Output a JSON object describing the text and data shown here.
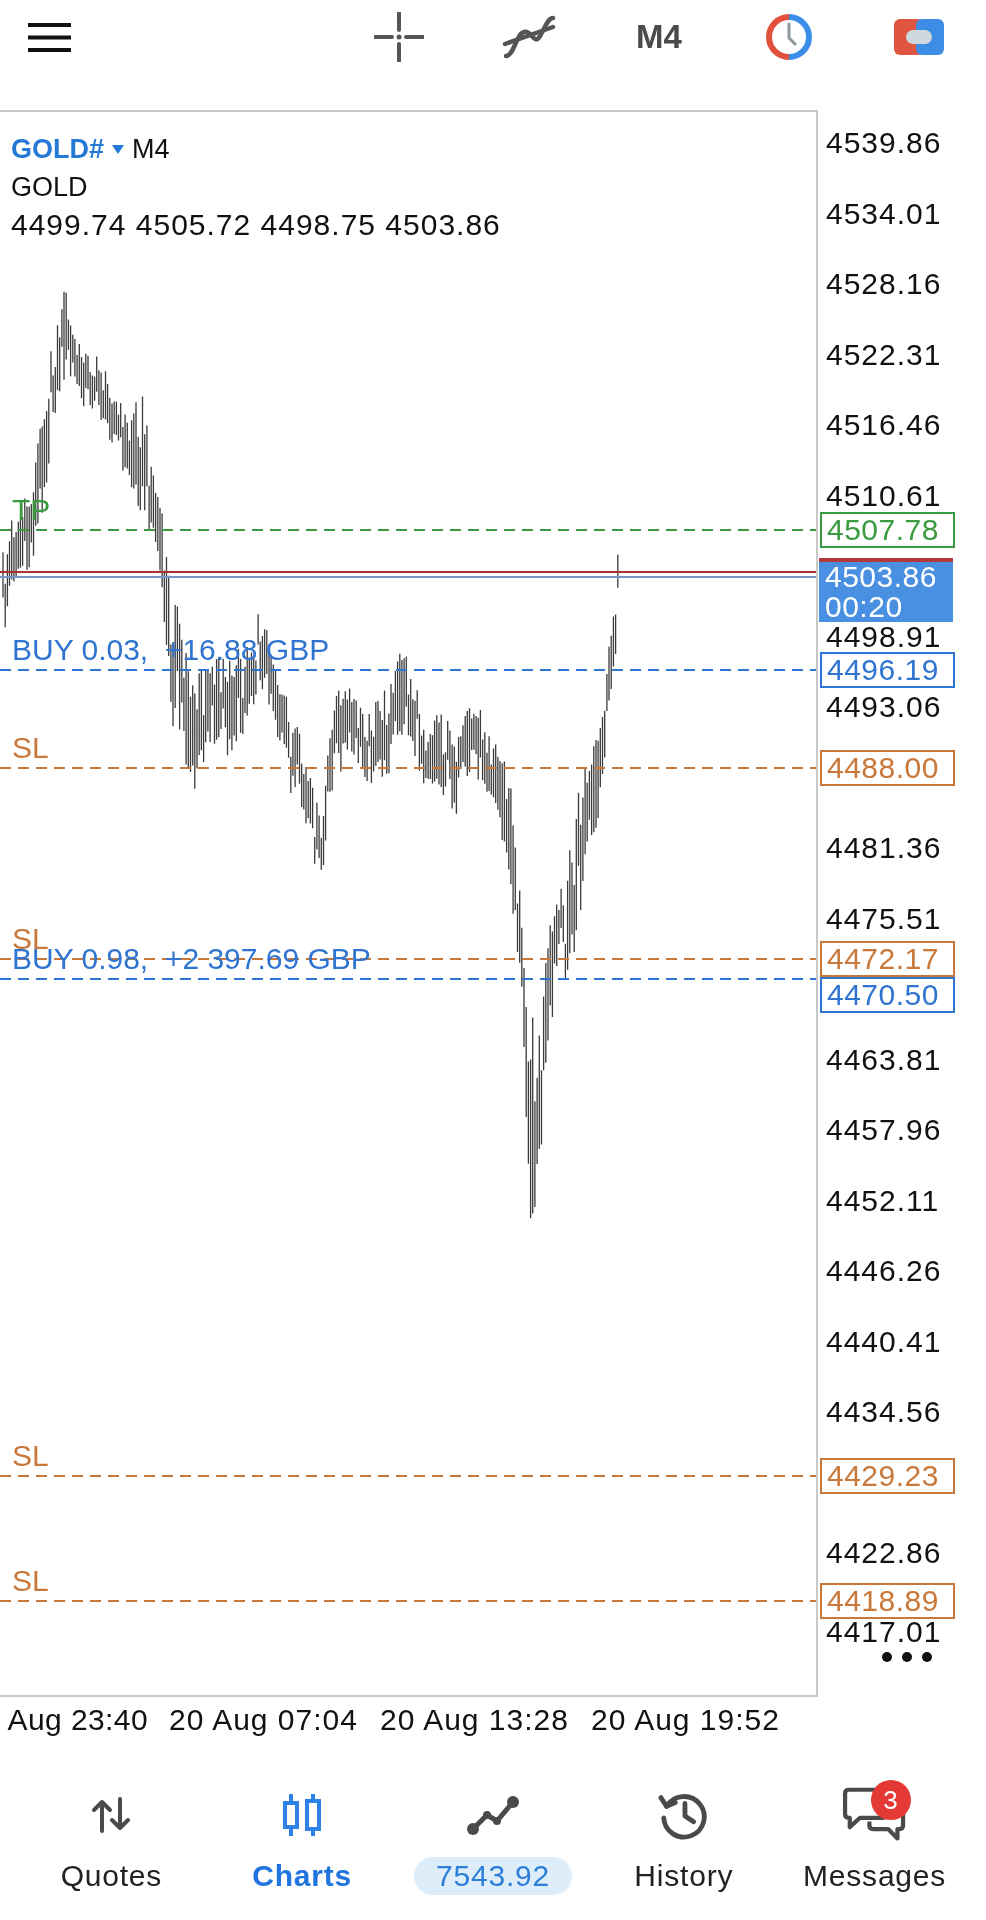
{
  "top_bar": {
    "timeframe": "M4"
  },
  "chart": {
    "symbol": "GOLD#",
    "timeframe": "M4",
    "description": "GOLD",
    "ohlc": "4499.74 4505.72 4498.75 4503.86",
    "price_axis": [
      "4539.86",
      "4534.01",
      "4528.16",
      "4522.31",
      "4516.46",
      "4510.61",
      "4498.91",
      "4493.06",
      "4481.36",
      "4475.51",
      "4463.81",
      "4457.96",
      "4452.11",
      "4446.26",
      "4440.41",
      "4434.56",
      "4422.86",
      "4417.01"
    ],
    "order_lines": [
      {
        "label": "TP",
        "price": "4507.78",
        "color": "#3a9a40"
      },
      {
        "label": "BUY 0.03,  +16.88 GBP",
        "price": "4496.19",
        "color": "#2f74d0"
      },
      {
        "label": "SL",
        "price": "4488.00",
        "color": "#c8783a"
      },
      {
        "label": "SL",
        "price": "4472.17",
        "color": "#c8783a"
      },
      {
        "label": "BUY 0.98,  +2 397.69 GBP",
        "price": "4470.50",
        "color": "#2f74d0"
      },
      {
        "label": "SL",
        "price": "4429.23",
        "color": "#c8783a"
      },
      {
        "label": "SL",
        "price": "4418.89",
        "color": "#c8783a"
      }
    ],
    "current_price": {
      "price": "4503.86",
      "countdown": "00:20"
    },
    "time_axis": [
      "Aug 23:40",
      "20 Aug 07:04",
      "20 Aug 13:28",
      "20 Aug 19:52"
    ]
  },
  "bottom_nav": [
    {
      "kind": "label",
      "label": "Quotes",
      "selected": false
    },
    {
      "kind": "label",
      "label": "Charts",
      "selected": true
    },
    {
      "kind": "pill",
      "label": "7543.92",
      "selected": false
    },
    {
      "kind": "label",
      "label": "History",
      "selected": false
    },
    {
      "kind": "label",
      "label": "Messages",
      "selected": false,
      "badge": "3"
    }
  ]
}
